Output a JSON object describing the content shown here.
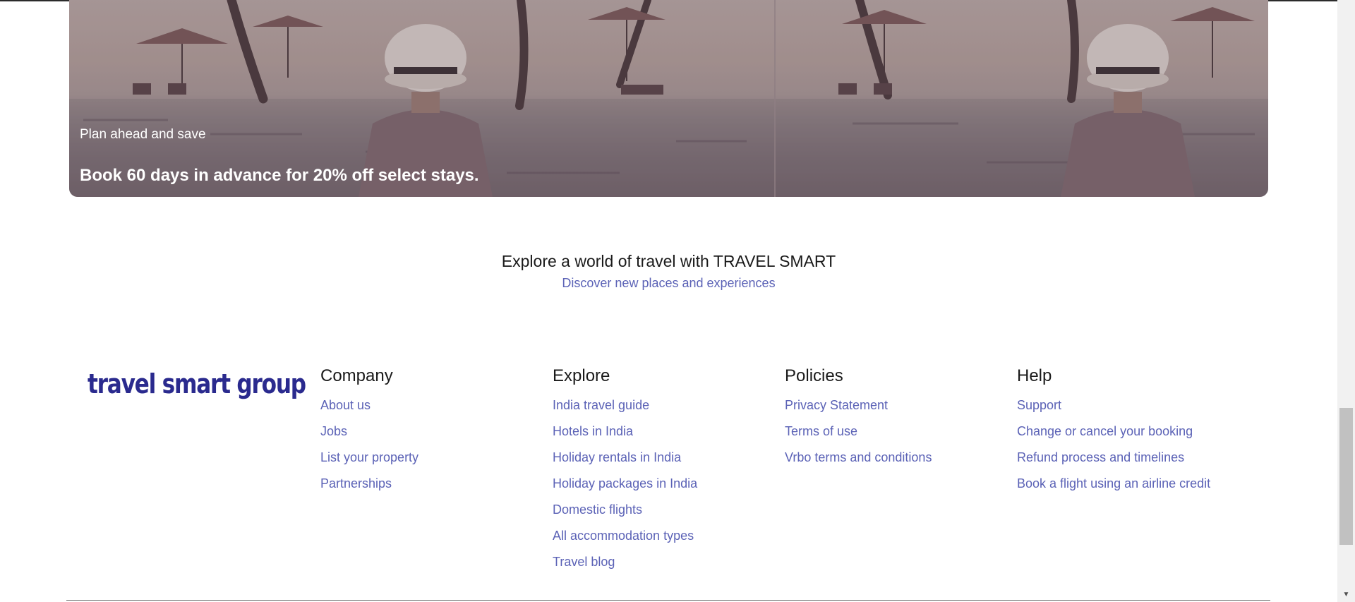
{
  "banner": {
    "eyebrow": "Plan ahead and save",
    "headline": "Book 60 days in advance for 20% off select stays."
  },
  "explore": {
    "title": "Explore a world of travel with TRAVEL SMART",
    "subtitle": "Discover new places and experiences"
  },
  "footer": {
    "logo": "travel smart group",
    "columns": [
      {
        "heading": "Company",
        "links": [
          "About us",
          "Jobs",
          "List your property",
          "Partnerships"
        ]
      },
      {
        "heading": "Explore",
        "links": [
          "India travel guide",
          "Hotels in India",
          "Holiday rentals in India",
          "Holiday packages in India",
          "Domestic flights",
          "All accommodation types",
          "Travel blog"
        ]
      },
      {
        "heading": "Policies",
        "links": [
          "Privacy Statement",
          "Terms of use",
          "Vrbo terms and conditions"
        ]
      },
      {
        "heading": "Help",
        "links": [
          "Support",
          "Change or cancel your booking",
          "Refund process and timelines",
          "Book a flight using an airline credit"
        ]
      }
    ]
  },
  "colors": {
    "link": "#5b62b6",
    "logo": "#2a2a8e",
    "heading": "#1a1a1a"
  },
  "icons": {
    "scroll_down": "chevron-down-icon"
  }
}
